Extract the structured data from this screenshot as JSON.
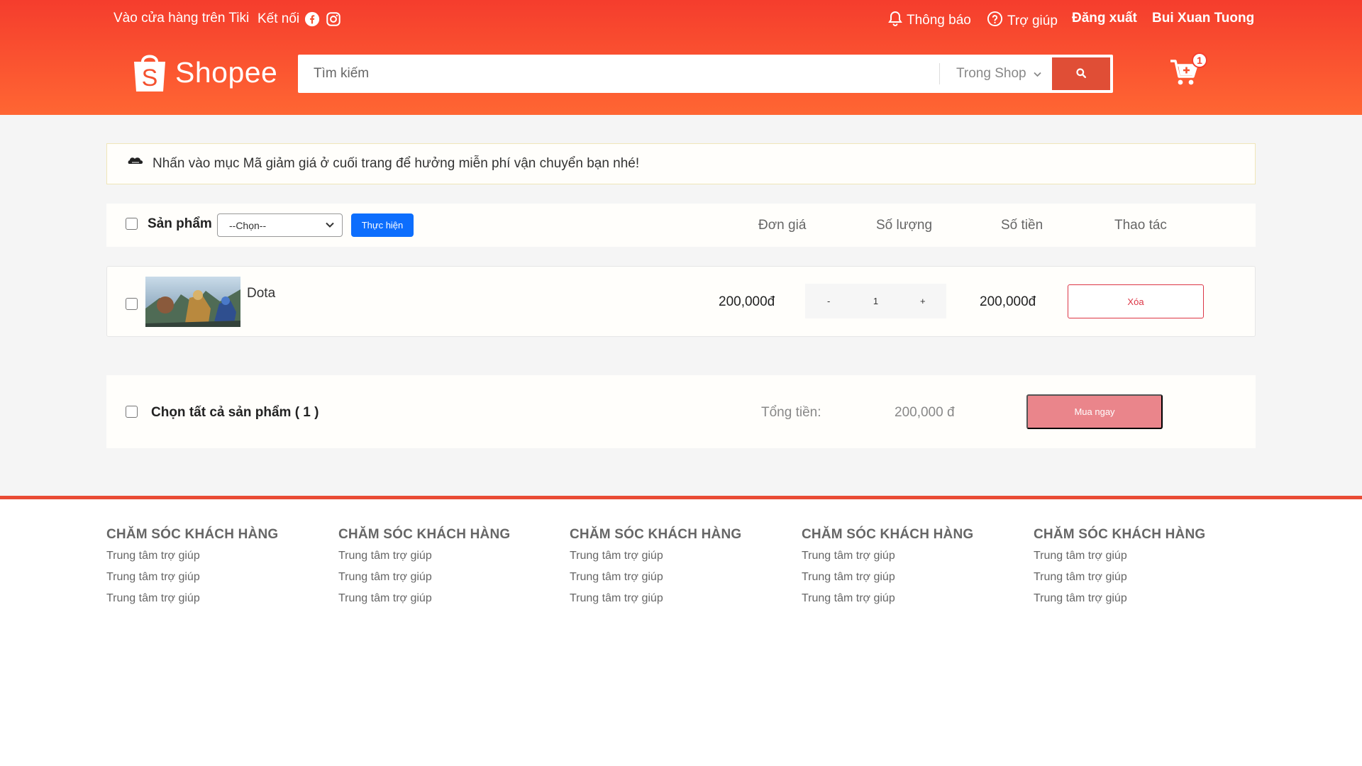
{
  "topbar": {
    "left_link": "Vào cửa hàng trên Tiki",
    "connect_label": "Kết nối",
    "notifications": "Thông báo",
    "help": "Trợ giúp",
    "logout": "Đăng xuất",
    "username": "Bui Xuan Tuong"
  },
  "brand": {
    "name": "Shopee",
    "logo_letter": "S"
  },
  "search": {
    "placeholder": "Tìm kiếm",
    "scope": "Trong Shop"
  },
  "cart": {
    "count": "1"
  },
  "notice": {
    "text": "Nhấn vào mục Mã giảm giá ở cuối trang để hưởng miễn phí vận chuyển bạn nhé!"
  },
  "cart_table": {
    "header": {
      "product": "Sản phẩm",
      "select_value": "--Chọn--",
      "apply_button": "Thực hiện",
      "unit_price": "Đơn giá",
      "quantity": "Số lượng",
      "amount": "Số tiền",
      "action": "Thao tác"
    },
    "items": [
      {
        "name": "Dota",
        "unit_price": "200,000đ",
        "quantity": "1",
        "amount": "200,000đ",
        "decrease": "-",
        "increase": "+",
        "delete_label": "Xóa"
      }
    ]
  },
  "summary": {
    "select_all": "Chọn tất cả sản phẩm ( 1 )",
    "total_label": "Tổng tiền:",
    "total_value": "200,000 đ",
    "buy_button": "Mua ngay"
  },
  "footer": {
    "columns": [
      {
        "title": "CHĂM SÓC KHÁCH HÀNG",
        "links": [
          "Trung tâm trợ giúp",
          "Trung tâm trợ giúp",
          "Trung tâm trợ giúp"
        ]
      },
      {
        "title": "CHĂM SÓC KHÁCH HÀNG",
        "links": [
          "Trung tâm trợ giúp",
          "Trung tâm trợ giúp",
          "Trung tâm trợ giúp"
        ]
      },
      {
        "title": "CHĂM SÓC KHÁCH HÀNG",
        "links": [
          "Trung tâm trợ giúp",
          "Trung tâm trợ giúp",
          "Trung tâm trợ giúp"
        ]
      },
      {
        "title": "CHĂM SÓC KHÁCH HÀNG",
        "links": [
          "Trung tâm trợ giúp",
          "Trung tâm trợ giúp",
          "Trung tâm trợ giúp"
        ]
      },
      {
        "title": "CHĂM SÓC KHÁCH HÀNG",
        "links": [
          "Trung tâm trợ giúp",
          "Trung tâm trợ giúp",
          "Trung tâm trợ giúp"
        ]
      }
    ]
  },
  "colors": {
    "brand": "#f53d2d",
    "brand_light": "#ff6633",
    "primary_button": "#0d6efd",
    "danger": "#dc3545",
    "buy_button": "#ea858b"
  },
  "icons": [
    "facebook-icon",
    "instagram-icon",
    "bell-icon",
    "help-icon",
    "search-icon",
    "cart-icon",
    "chevron-down-icon",
    "promo-icon"
  ]
}
